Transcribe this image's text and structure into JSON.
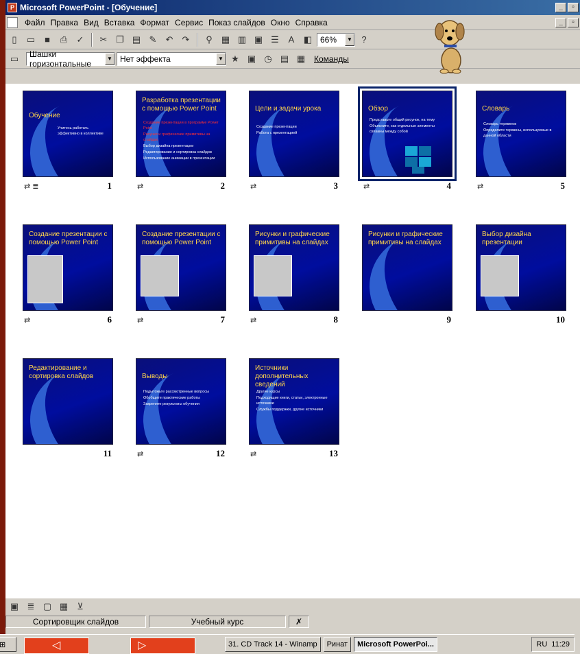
{
  "window": {
    "title": "Microsoft PowerPoint - [Обучение]"
  },
  "menu": [
    "Файл",
    "Правка",
    "Вид",
    "Вставка",
    "Формат",
    "Сервис",
    "Показ слайдов",
    "Окно",
    "Справка"
  ],
  "toolbar": {
    "zoom": "66%"
  },
  "sorter_toolbar": {
    "transition": "Шашки горизонтальные",
    "effect": "Нет эффекта",
    "commands": "Команды"
  },
  "slides": [
    {
      "num": "1",
      "title": "Обучение",
      "bullets": [
        "Учитесь работать эффективно в коллективе"
      ],
      "selected": false
    },
    {
      "num": "2",
      "title": "Разработка презентации с помощью Power Point",
      "bullets": [
        "Создание презентации в программе Power Point",
        "Рисунки и графические примитивы на слайдах",
        "Выбор дизайна презентации",
        "Редактирование и сортировка слайдов",
        "Использование анимации в презентации"
      ],
      "selected": false
    },
    {
      "num": "3",
      "title": "Цели и задачи урока",
      "bullets": [
        "Создание презентации",
        "Работа с презентацией"
      ],
      "selected": false
    },
    {
      "num": "4",
      "title": "Обзор",
      "bullets": [
        "Представьте общий рисунок, на тему",
        "Объясните, как отдельные элементы связаны между собой"
      ],
      "selected": true
    },
    {
      "num": "5",
      "title": "Словарь",
      "bullets": [
        "Словарь терминов",
        "Определите термины, используемые в данной области"
      ],
      "selected": false
    },
    {
      "num": "6",
      "title": "Создание презентации с помощью Power Point",
      "bullets": [],
      "selected": false
    },
    {
      "num": "7",
      "title": "Создание презентации с помощью Power Point",
      "bullets": [],
      "selected": false
    },
    {
      "num": "8",
      "title": "Рисунки и графические примитивы на слайдах",
      "bullets": [],
      "selected": false
    },
    {
      "num": "9",
      "title": "Рисунки и графические примитивы на слайдах",
      "bullets": [],
      "selected": false
    },
    {
      "num": "10",
      "title": "Выбор дизайна презентации",
      "bullets": [],
      "selected": false
    },
    {
      "num": "11",
      "title": "Редактирование и сортировка слайдов",
      "bullets": [],
      "selected": false
    },
    {
      "num": "12",
      "title": "Выводы",
      "bullets": [
        "Подытожьте рассмотренные вопросы",
        "Обобщите практические работы",
        "Закрепите результаты обучения"
      ],
      "selected": false
    },
    {
      "num": "13",
      "title": "Источники дополнительных сведений",
      "bullets": [
        "Другие курсы",
        "Подходящие книги, статьи, электронные источники",
        "Службы поддержки, другие источники"
      ],
      "selected": false
    }
  ],
  "status": {
    "view": "Сортировщик слайдов",
    "design": "Учебный курс"
  },
  "taskbar": {
    "items": [
      "31. CD Track 14 - Winamp",
      "Ринат",
      "Microsoft PowerPoi..."
    ],
    "lang": "RU",
    "time": "11:29"
  }
}
